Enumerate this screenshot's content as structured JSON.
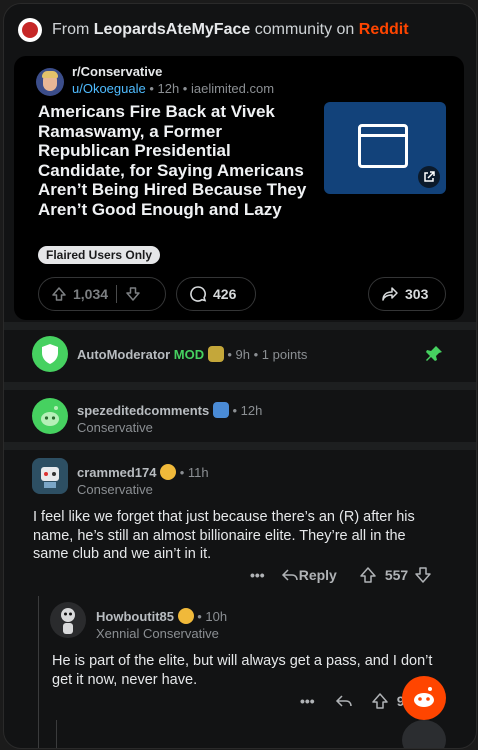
{
  "header": {
    "prefix": "From ",
    "community": "LeopardsAteMyFace",
    "middle": " community on ",
    "brand": "Reddit"
  },
  "post": {
    "subreddit": "r/Conservative",
    "author": "u/Okoeguale",
    "meta_rest": " • 12h • iaelimited.com",
    "title": "Americans Fire Back at Vivek Ramaswamy, a Former Republican Presidential Candidate, for Saying Americans Aren’t Being Hired Because They Aren’t Good Enough and Lazy",
    "flair": "Flaired Users Only",
    "upvotes": "1,034",
    "comments": "426",
    "shares": "303"
  },
  "comments": [
    {
      "username": "AutoModerator",
      "mod_label": "MOD",
      "meta": " • 9h • 1 points"
    },
    {
      "username": "spezeditedcomments",
      "meta": " • 12h",
      "flair": "Conservative"
    },
    {
      "username": "crammed174",
      "meta": " • 11h",
      "flair": "Conservative",
      "body": "I feel like we forget that just because there’s an (R) after his name, he’s still an almost billionaire elite. They’re all in the same club and we ain’t in it.",
      "reply_label": "Reply",
      "score": "557",
      "more": "•••"
    },
    {
      "username": "Howboutit85",
      "meta": " • 10h",
      "flair": "Xennial Conservative",
      "body": "He is part of the elite, but will always get a pass, and I don’t get it now, never have.",
      "score": "95",
      "more": "•••"
    }
  ],
  "colors": {
    "accent": "#ff4500",
    "mod": "#46d160",
    "link": "#4fbcff"
  }
}
